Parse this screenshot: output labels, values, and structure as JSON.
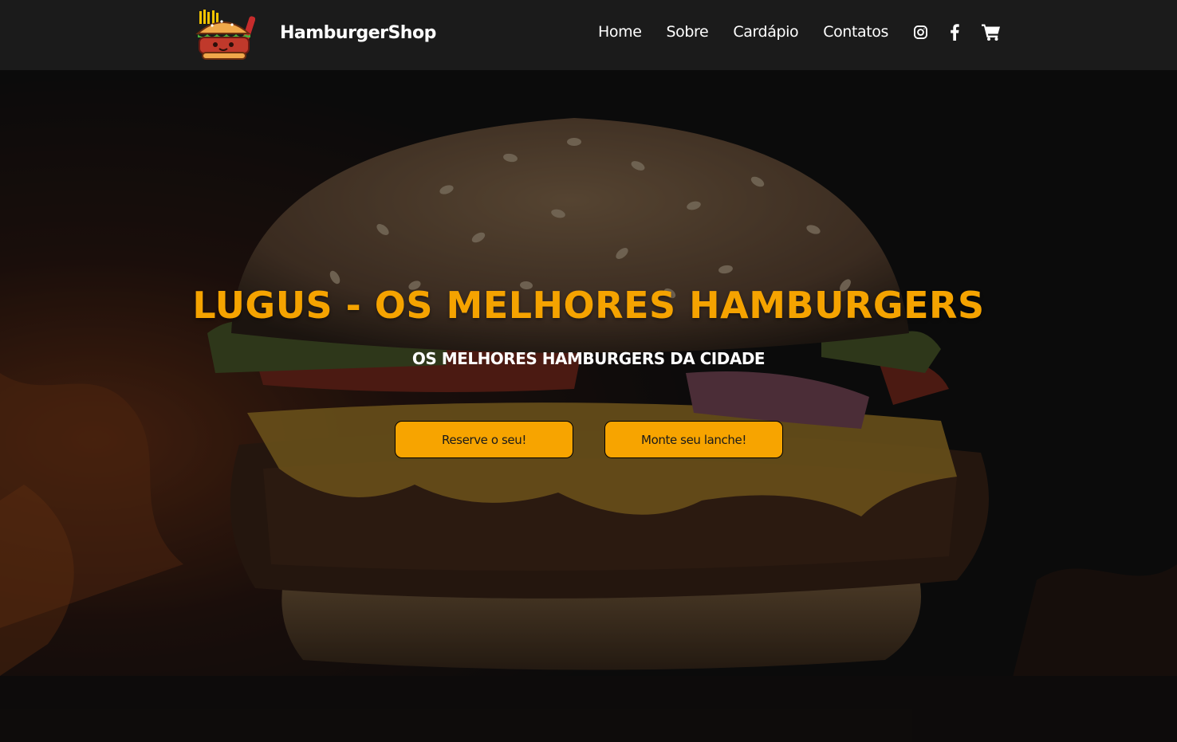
{
  "brand": {
    "name": "HamburgerShop",
    "logo_icon": "burger-mascot-icon"
  },
  "nav": {
    "items": [
      {
        "label": "Home"
      },
      {
        "label": "Sobre"
      },
      {
        "label": "Cardápio"
      },
      {
        "label": "Contatos"
      }
    ],
    "icons": [
      "instagram-icon",
      "facebook-icon",
      "cart-icon"
    ]
  },
  "hero": {
    "title": "LUGUS - OS MELHORES HAMBURGERS",
    "subtitle": "OS MELHORES HAMBURGERS DA CIDADE",
    "buttons": {
      "reserve": "Reserve o seu!",
      "build": "Monte seu lanche!"
    }
  },
  "colors": {
    "accent": "#f7a400",
    "header_bg": "#1b1b1b",
    "title": "#f5a300"
  }
}
